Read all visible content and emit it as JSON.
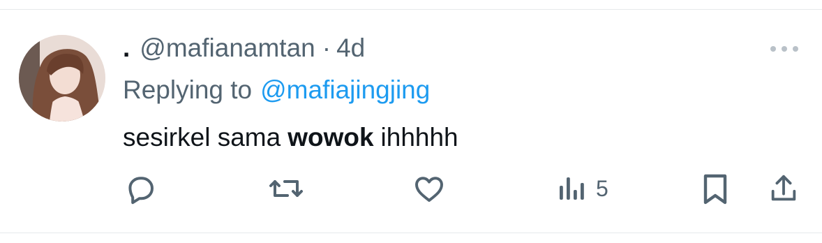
{
  "tweet": {
    "display_name": ".",
    "handle": "@mafianamtan",
    "separator": "·",
    "time": "4d",
    "replying_prefix": "Replying to",
    "replying_to": "@mafiajingjing",
    "text_before": "sesirkel sama",
    "text_bold": "wowok",
    "text_after": "ihhhhh"
  },
  "actions": {
    "reply_icon": "reply-icon",
    "retweet_icon": "retweet-icon",
    "like_icon": "heart-icon",
    "views_icon": "analytics-icon",
    "views_count": "5",
    "bookmark_icon": "bookmark-icon",
    "share_icon": "share-icon",
    "more_icon": "more-icon"
  },
  "colors": {
    "text_primary": "#0f1419",
    "text_secondary": "#536471",
    "link": "#1d9bf0",
    "divider": "#e6e9eb"
  }
}
